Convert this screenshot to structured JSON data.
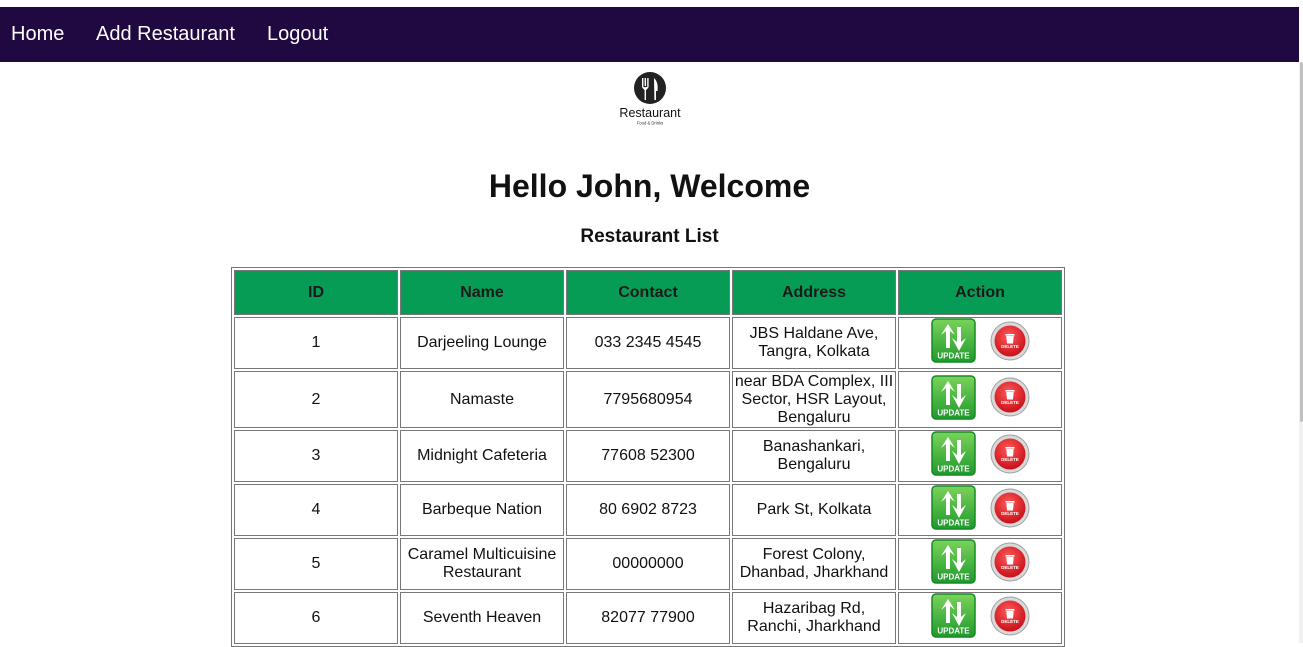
{
  "nav": {
    "home": "Home",
    "add_restaurant": "Add Restaurant",
    "logout": "Logout"
  },
  "logo": {
    "title": "Restaurant",
    "subtitle": "Food & Drinks",
    "icon": "fork-knife-icon"
  },
  "welcome": "Hello John, Welcome",
  "list_title": "Restaurant List",
  "table": {
    "headers": [
      "ID",
      "Name",
      "Contact",
      "Address",
      "Action"
    ],
    "rows": [
      {
        "id": "1",
        "name": "Darjeeling Lounge",
        "contact": "033 2345 4545",
        "address": "JBS Haldane Ave, Tangra, Kolkata"
      },
      {
        "id": "2",
        "name": "Namaste",
        "contact": "7795680954",
        "address": "near BDA Complex, III Sector, HSR Layout, Bengaluru"
      },
      {
        "id": "3",
        "name": "Midnight Cafeteria",
        "contact": "77608 52300",
        "address": "Banashankari, Bengaluru"
      },
      {
        "id": "4",
        "name": "Barbeque Nation",
        "contact": "80 6902 8723",
        "address": "Park St, Kolkata"
      },
      {
        "id": "5",
        "name": "Caramel Multicuisine Restaurant",
        "contact": "00000000",
        "address": "Forest Colony, Dhanbad, Jharkhand"
      },
      {
        "id": "6",
        "name": "Seventh Heaven",
        "contact": "82077 77900",
        "address": "Hazaribag Rd, Ranchi, Jharkhand"
      }
    ],
    "update_label": "UPDATE",
    "delete_label": "DELETE"
  },
  "colors": {
    "navbar": "#200840",
    "header_bg": "#069c55",
    "update_green": "#2fb33a",
    "delete_red": "#d9121f"
  }
}
